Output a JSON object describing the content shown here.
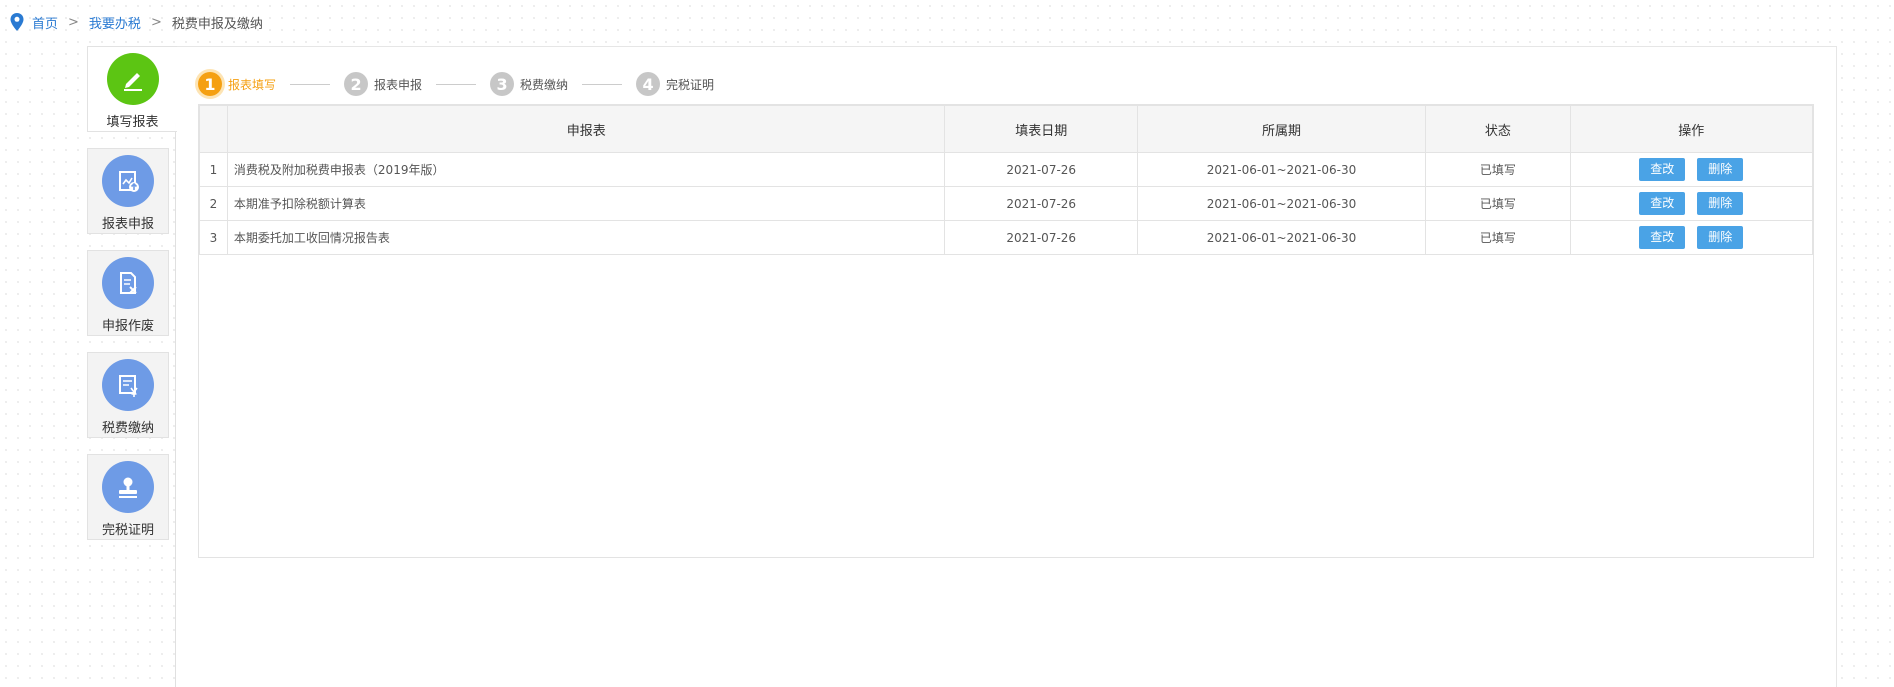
{
  "breadcrumb": {
    "items": [
      "首页",
      "我要办税",
      "税费申报及缴纳"
    ],
    "separator": ">"
  },
  "sidebar": {
    "items": [
      {
        "label": "填写报表",
        "icon": "pencil-icon",
        "active": true
      },
      {
        "label": "报表申报",
        "icon": "report-upload-icon",
        "active": false
      },
      {
        "label": "申报作废",
        "icon": "document-void-icon",
        "active": false
      },
      {
        "label": "税费缴纳",
        "icon": "tax-payment-icon",
        "active": false
      },
      {
        "label": "完税证明",
        "icon": "stamp-icon",
        "active": false
      }
    ]
  },
  "steps": [
    {
      "num": "1",
      "label": "报表填写",
      "active": true
    },
    {
      "num": "2",
      "label": "报表申报",
      "active": false
    },
    {
      "num": "3",
      "label": "税费缴纳",
      "active": false
    },
    {
      "num": "4",
      "label": "完税证明",
      "active": false
    }
  ],
  "table": {
    "headers": [
      "",
      "申报表",
      "填表日期",
      "所属期",
      "状态",
      "操作"
    ],
    "rows": [
      {
        "no": "1",
        "name": "消费税及附加税费申报表（2019年版）",
        "date": "2021-07-26",
        "period": "2021-06-01~2021-06-30",
        "status": "已填写"
      },
      {
        "no": "2",
        "name": "本期准予扣除税额计算表",
        "date": "2021-07-26",
        "period": "2021-06-01~2021-06-30",
        "status": "已填写"
      },
      {
        "no": "3",
        "name": "本期委托加工收回情况报告表",
        "date": "2021-07-26",
        "period": "2021-06-01~2021-06-30",
        "status": "已填写"
      }
    ],
    "actions": {
      "edit": "查改",
      "delete": "删除"
    }
  },
  "colors": {
    "link": "#2a7ad2",
    "active_step": "#f5a012",
    "active_tab_circle": "#5cc513",
    "tab_circle": "#6e9be6",
    "button": "#4aa3e6"
  }
}
